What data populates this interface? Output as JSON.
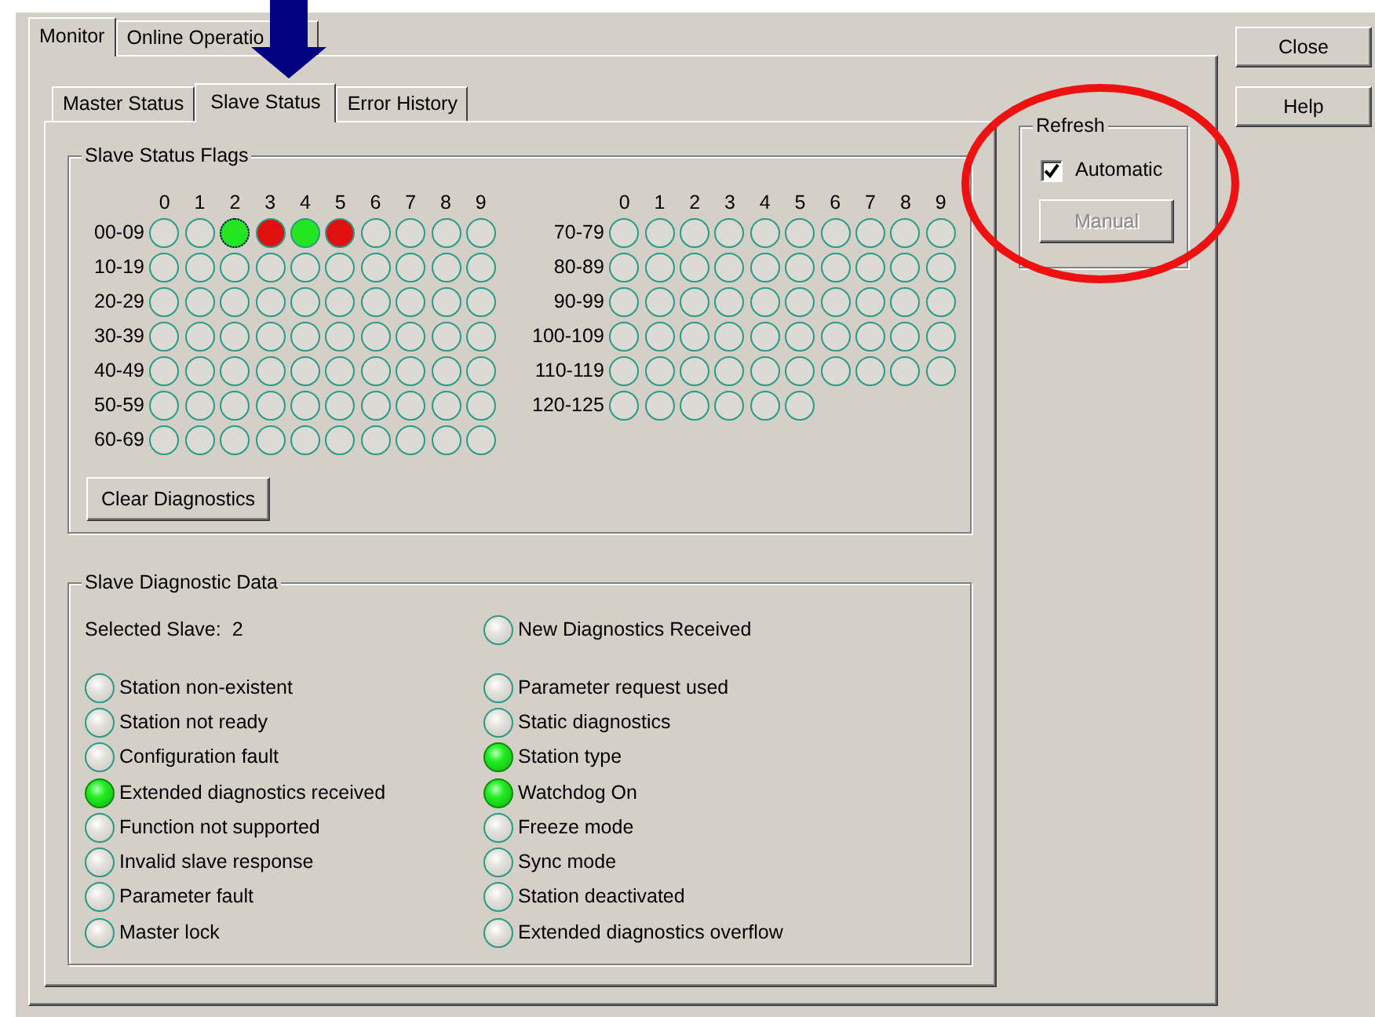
{
  "window": {
    "buttons": [
      {
        "label": "Close"
      },
      {
        "label": "Help"
      }
    ]
  },
  "outer_tabs": [
    {
      "label": "Monitor",
      "selected": true
    },
    {
      "label": "Online Operatio",
      "selected": false
    }
  ],
  "inner_tabs": [
    {
      "label": "Master Status",
      "selected": false
    },
    {
      "label": "Slave Status",
      "selected": true
    },
    {
      "label": "Error History",
      "selected": false
    }
  ],
  "slave_status_flags": {
    "title": "Slave Status Flags",
    "left_column_headers": [
      "0",
      "1",
      "2",
      "3",
      "4",
      "5",
      "6",
      "7",
      "8",
      "9"
    ],
    "right_column_headers": [
      "0",
      "1",
      "2",
      "3",
      "4",
      "5",
      "6",
      "7",
      "8",
      "9"
    ],
    "left_rows": [
      {
        "label": "00-09",
        "leds": [
          {
            "color": "#dcdad4",
            "focused": false
          },
          {
            "color": "#dcdad4",
            "focused": false
          },
          {
            "color": "#22e622",
            "focused": true
          },
          {
            "color": "#e01010",
            "focused": false
          },
          {
            "color": "#22e622",
            "focused": false
          },
          {
            "color": "#e01010",
            "focused": false
          },
          {
            "color": "#dcdad4",
            "focused": false
          },
          {
            "color": "#dcdad4",
            "focused": false
          },
          {
            "color": "#dcdad4",
            "focused": false
          },
          {
            "color": "#dcdad4",
            "focused": false
          }
        ]
      },
      {
        "label": "10-19",
        "leds": [
          {
            "color": "#dcdad4",
            "focused": false
          },
          {
            "color": "#dcdad4",
            "focused": false
          },
          {
            "color": "#dcdad4",
            "focused": false
          },
          {
            "color": "#dcdad4",
            "focused": false
          },
          {
            "color": "#dcdad4",
            "focused": false
          },
          {
            "color": "#dcdad4",
            "focused": false
          },
          {
            "color": "#dcdad4",
            "focused": false
          },
          {
            "color": "#dcdad4",
            "focused": false
          },
          {
            "color": "#dcdad4",
            "focused": false
          },
          {
            "color": "#dcdad4",
            "focused": false
          }
        ]
      },
      {
        "label": "20-29",
        "leds": [
          {
            "color": "#dcdad4",
            "focused": false
          },
          {
            "color": "#dcdad4",
            "focused": false
          },
          {
            "color": "#dcdad4",
            "focused": false
          },
          {
            "color": "#dcdad4",
            "focused": false
          },
          {
            "color": "#dcdad4",
            "focused": false
          },
          {
            "color": "#dcdad4",
            "focused": false
          },
          {
            "color": "#dcdad4",
            "focused": false
          },
          {
            "color": "#dcdad4",
            "focused": false
          },
          {
            "color": "#dcdad4",
            "focused": false
          },
          {
            "color": "#dcdad4",
            "focused": false
          }
        ]
      },
      {
        "label": "30-39",
        "leds": [
          {
            "color": "#dcdad4",
            "focused": false
          },
          {
            "color": "#dcdad4",
            "focused": false
          },
          {
            "color": "#dcdad4",
            "focused": false
          },
          {
            "color": "#dcdad4",
            "focused": false
          },
          {
            "color": "#dcdad4",
            "focused": false
          },
          {
            "color": "#dcdad4",
            "focused": false
          },
          {
            "color": "#dcdad4",
            "focused": false
          },
          {
            "color": "#dcdad4",
            "focused": false
          },
          {
            "color": "#dcdad4",
            "focused": false
          },
          {
            "color": "#dcdad4",
            "focused": false
          }
        ]
      },
      {
        "label": "40-49",
        "leds": [
          {
            "color": "#dcdad4",
            "focused": false
          },
          {
            "color": "#dcdad4",
            "focused": false
          },
          {
            "color": "#dcdad4",
            "focused": false
          },
          {
            "color": "#dcdad4",
            "focused": false
          },
          {
            "color": "#dcdad4",
            "focused": false
          },
          {
            "color": "#dcdad4",
            "focused": false
          },
          {
            "color": "#dcdad4",
            "focused": false
          },
          {
            "color": "#dcdad4",
            "focused": false
          },
          {
            "color": "#dcdad4",
            "focused": false
          },
          {
            "color": "#dcdad4",
            "focused": false
          }
        ]
      },
      {
        "label": "50-59",
        "leds": [
          {
            "color": "#dcdad4",
            "focused": false
          },
          {
            "color": "#dcdad4",
            "focused": false
          },
          {
            "color": "#dcdad4",
            "focused": false
          },
          {
            "color": "#dcdad4",
            "focused": false
          },
          {
            "color": "#dcdad4",
            "focused": false
          },
          {
            "color": "#dcdad4",
            "focused": false
          },
          {
            "color": "#dcdad4",
            "focused": false
          },
          {
            "color": "#dcdad4",
            "focused": false
          },
          {
            "color": "#dcdad4",
            "focused": false
          },
          {
            "color": "#dcdad4",
            "focused": false
          }
        ]
      },
      {
        "label": "60-69",
        "leds": [
          {
            "color": "#dcdad4",
            "focused": false
          },
          {
            "color": "#dcdad4",
            "focused": false
          },
          {
            "color": "#dcdad4",
            "focused": false
          },
          {
            "color": "#dcdad4",
            "focused": false
          },
          {
            "color": "#dcdad4",
            "focused": false
          },
          {
            "color": "#dcdad4",
            "focused": false
          },
          {
            "color": "#dcdad4",
            "focused": false
          },
          {
            "color": "#dcdad4",
            "focused": false
          },
          {
            "color": "#dcdad4",
            "focused": false
          },
          {
            "color": "#dcdad4",
            "focused": false
          }
        ]
      }
    ],
    "right_rows": [
      {
        "label": "70-79",
        "leds": [
          {
            "color": "#dcdad4",
            "focused": false
          },
          {
            "color": "#dcdad4",
            "focused": false
          },
          {
            "color": "#dcdad4",
            "focused": false
          },
          {
            "color": "#dcdad4",
            "focused": false
          },
          {
            "color": "#dcdad4",
            "focused": false
          },
          {
            "color": "#dcdad4",
            "focused": false
          },
          {
            "color": "#dcdad4",
            "focused": false
          },
          {
            "color": "#dcdad4",
            "focused": false
          },
          {
            "color": "#dcdad4",
            "focused": false
          },
          {
            "color": "#dcdad4",
            "focused": false
          }
        ]
      },
      {
        "label": "80-89",
        "leds": [
          {
            "color": "#dcdad4",
            "focused": false
          },
          {
            "color": "#dcdad4",
            "focused": false
          },
          {
            "color": "#dcdad4",
            "focused": false
          },
          {
            "color": "#dcdad4",
            "focused": false
          },
          {
            "color": "#dcdad4",
            "focused": false
          },
          {
            "color": "#dcdad4",
            "focused": false
          },
          {
            "color": "#dcdad4",
            "focused": false
          },
          {
            "color": "#dcdad4",
            "focused": false
          },
          {
            "color": "#dcdad4",
            "focused": false
          },
          {
            "color": "#dcdad4",
            "focused": false
          }
        ]
      },
      {
        "label": "90-99",
        "leds": [
          {
            "color": "#dcdad4",
            "focused": false
          },
          {
            "color": "#dcdad4",
            "focused": false
          },
          {
            "color": "#dcdad4",
            "focused": false
          },
          {
            "color": "#dcdad4",
            "focused": false
          },
          {
            "color": "#dcdad4",
            "focused": false
          },
          {
            "color": "#dcdad4",
            "focused": false
          },
          {
            "color": "#dcdad4",
            "focused": false
          },
          {
            "color": "#dcdad4",
            "focused": false
          },
          {
            "color": "#dcdad4",
            "focused": false
          },
          {
            "color": "#dcdad4",
            "focused": false
          }
        ]
      },
      {
        "label": "100-109",
        "leds": [
          {
            "color": "#dcdad4",
            "focused": false
          },
          {
            "color": "#dcdad4",
            "focused": false
          },
          {
            "color": "#dcdad4",
            "focused": false
          },
          {
            "color": "#dcdad4",
            "focused": false
          },
          {
            "color": "#dcdad4",
            "focused": false
          },
          {
            "color": "#dcdad4",
            "focused": false
          },
          {
            "color": "#dcdad4",
            "focused": false
          },
          {
            "color": "#dcdad4",
            "focused": false
          },
          {
            "color": "#dcdad4",
            "focused": false
          },
          {
            "color": "#dcdad4",
            "focused": false
          }
        ]
      },
      {
        "label": "110-119",
        "leds": [
          {
            "color": "#dcdad4",
            "focused": false
          },
          {
            "color": "#dcdad4",
            "focused": false
          },
          {
            "color": "#dcdad4",
            "focused": false
          },
          {
            "color": "#dcdad4",
            "focused": false
          },
          {
            "color": "#dcdad4",
            "focused": false
          },
          {
            "color": "#dcdad4",
            "focused": false
          },
          {
            "color": "#dcdad4",
            "focused": false
          },
          {
            "color": "#dcdad4",
            "focused": false
          },
          {
            "color": "#dcdad4",
            "focused": false
          },
          {
            "color": "#dcdad4",
            "focused": false
          }
        ]
      },
      {
        "label": "120-125",
        "leds": [
          {
            "color": "#dcdad4",
            "focused": false
          },
          {
            "color": "#dcdad4",
            "focused": false
          },
          {
            "color": "#dcdad4",
            "focused": false
          },
          {
            "color": "#dcdad4",
            "focused": false
          },
          {
            "color": "#dcdad4",
            "focused": false
          },
          {
            "color": "#dcdad4",
            "focused": false
          }
        ]
      }
    ],
    "clear_button": "Clear Diagnostics"
  },
  "slave_diagnostic_data": {
    "title": "Slave Diagnostic Data",
    "selected_slave_label": "Selected Slave:",
    "selected_slave": "2",
    "new_diagnostics": {
      "label": "New Diagnostics Received",
      "on": false
    },
    "left_items": [
      {
        "label": "Station non-existent",
        "on": false
      },
      {
        "label": "Station not ready",
        "on": false
      },
      {
        "label": "Configuration fault",
        "on": false
      },
      {
        "label": "Extended diagnostics received",
        "on": true
      },
      {
        "label": "Function not supported",
        "on": false
      },
      {
        "label": "Invalid slave response",
        "on": false
      },
      {
        "label": "Parameter fault",
        "on": false
      },
      {
        "label": "Master lock",
        "on": false
      }
    ],
    "right_items": [
      {
        "label": "Parameter request used",
        "on": false
      },
      {
        "label": "Static diagnostics",
        "on": false
      },
      {
        "label": "Station type",
        "on": true
      },
      {
        "label": "Watchdog On",
        "on": true
      },
      {
        "label": "Freeze mode",
        "on": false
      },
      {
        "label": "Sync mode",
        "on": false
      },
      {
        "label": "Station deactivated",
        "on": false
      },
      {
        "label": "Extended diagnostics overflow",
        "on": false
      }
    ]
  },
  "refresh": {
    "title": "Refresh",
    "automatic": {
      "label": "Automatic",
      "checked": true
    },
    "manual": {
      "label": "Manual",
      "disabled": true
    }
  },
  "annotations": [
    {
      "kind": "arrow",
      "color": "#000080"
    },
    {
      "kind": "ellipse",
      "color": "#ee1111"
    }
  ]
}
